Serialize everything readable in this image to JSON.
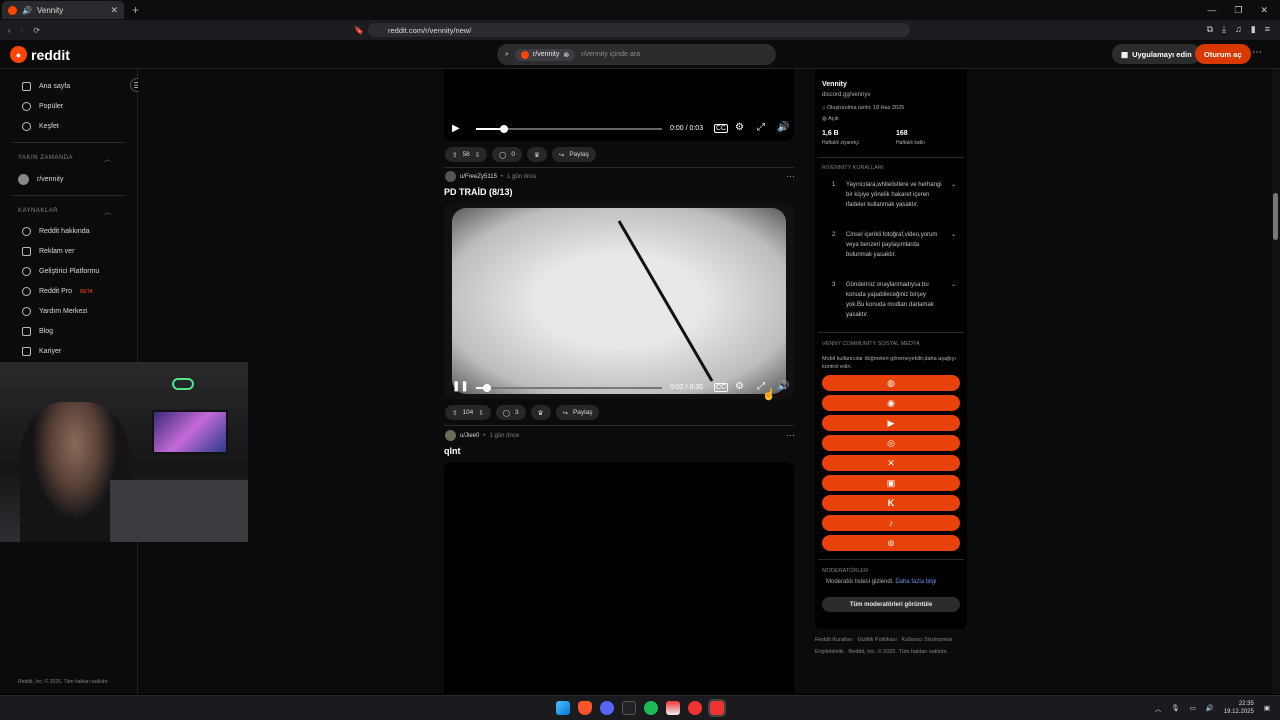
{
  "browser": {
    "tab_title": "Vennity",
    "url": "reddit.com/r/vennity/new/"
  },
  "header": {
    "logo_text": "reddit",
    "search_chip": "r/vennity",
    "search_placeholder": "r/vennity içinde ara",
    "get_app": "Uygulamayı edin",
    "login": "Oturum aç"
  },
  "sidebar": {
    "nav": [
      "Ana sayfa",
      "Popüler",
      "Keşfet"
    ],
    "recent_header": "YAKIN ZAMANDA",
    "recent": [
      "r/vennity"
    ],
    "resources_header": "KAYNAKLAR",
    "resources": [
      "Reddit hakkında",
      "Reklam ver",
      "Geliştirici Platformu",
      "Reddit Pro",
      "Yardım Merkezi",
      "Blog",
      "Kariyer"
    ],
    "beta": "BETA",
    "copyright": "Reddit, Inc. © 2025. Tüm hakları saklıdır."
  },
  "posts": [
    {
      "time": "0:00 / 0:03",
      "votes": "58",
      "comments": "0",
      "share": "Paylaş"
    },
    {
      "author": "u/FreeZy5115",
      "age": "1 gün önce",
      "title": "PD TRAİD (8/13)",
      "time": "0:02 / 0:35",
      "votes": "104",
      "comments": "3",
      "share": "Paylaş",
      "progress": 0.057
    },
    {
      "author": "u/Jiee0",
      "age": "1 gün önce",
      "title": "qlnt"
    }
  ],
  "community": {
    "name": "Vennity",
    "link": "discord.gg/vennyv",
    "created": "Oluşturulma tarihi: 18 Haz 2025",
    "visibility": "Açık",
    "visitors_value": "1,6 B",
    "visitors_label": "Haftalık ziyaretçi",
    "contrib_value": "168",
    "contrib_label": "Haftalık katkı",
    "rules_header": "R/VENNİTY KURALLARI",
    "rules": [
      {
        "n": "1",
        "text": "Yayıncılara,whitelistlere ve herhangi bir kişiye yönelik hakaret içeren ifadeler kullanmak yasaktır."
      },
      {
        "n": "2",
        "text": "Cinsel içerikli fotoğraf,video,yorum veya benzeri paylaşımlarda bulunmak yasaktır."
      },
      {
        "n": "3",
        "text": "Gönderiniz onaylanmadıysa bu konuda yapabileceğiniz birşey yok.Bu konuda modları darlamak yasaktır."
      }
    ],
    "social_header": "VENNY COMMUNİTY SOSYAL MEDYA",
    "social_note": "Mobil kullanıcılar düğmeleri göremeyebilir,daha aşağıyı kontrol edin.",
    "social_icons": [
      "globe-icon",
      "discord-icon",
      "youtube-icon",
      "instagram-icon",
      "x-icon",
      "twitch-icon",
      "kick-icon",
      "tiktok-icon",
      "steam-icon"
    ],
    "mods_header": "MODERATÖRLER",
    "mods_hidden": "Moderatör listesi gizlendi.",
    "mods_more": "Daha fazla bilgi",
    "mods_button": "Tüm moderatörleri görüntüle"
  },
  "footer": {
    "line1": [
      "Reddit Kuralları",
      "Gizlilik Politikası",
      "Kullanıcı Sözleşmesi"
    ],
    "line2": [
      "Erişilebilirlik",
      "Reddit, Inc. © 2025. Tüm hakları saklıdır."
    ]
  },
  "taskbar": {
    "time": "22:35",
    "date": "19.12.2025"
  },
  "colors": {
    "accent": "#ff4500",
    "social": "#e8420a",
    "bg": "#0b0b0b"
  }
}
